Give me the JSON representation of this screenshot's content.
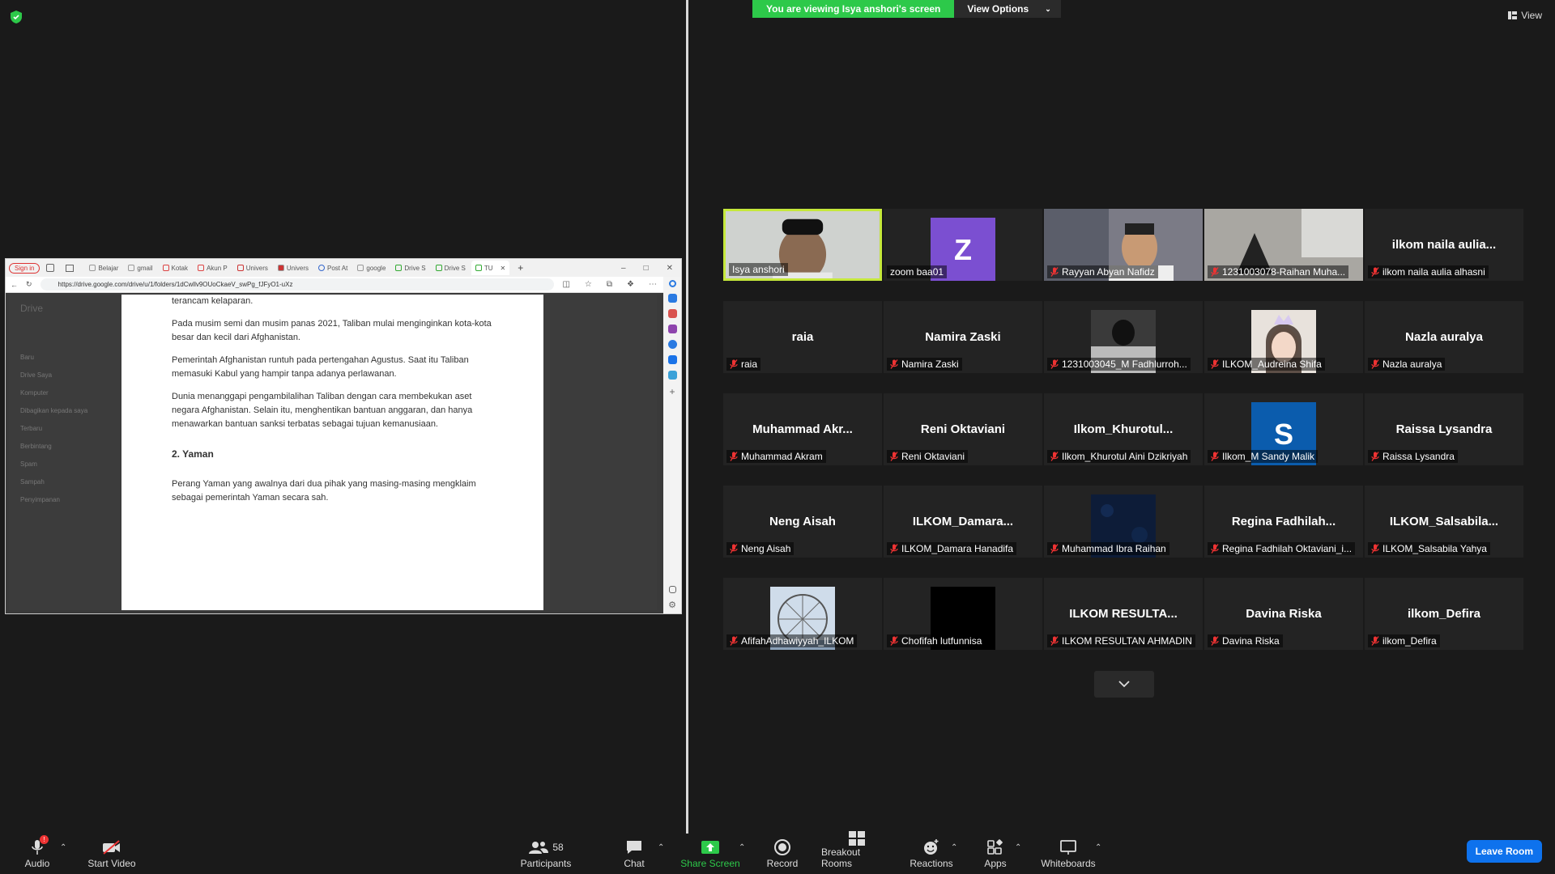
{
  "banner": {
    "viewing": "You are viewing Isya anshori's screen",
    "view_options": "View Options",
    "view": "View"
  },
  "shared": {
    "signin": "Sign in",
    "tabs": [
      "Belajar",
      "gmail",
      "Kotak",
      "Akun P",
      "Univers",
      "Univers",
      "Post At",
      "google",
      "Drive S",
      "Drive S",
      "TU"
    ],
    "url": "https://drive.google.com/drive/u/1/folders/1dCwllv9OUoCkaeV_swPg_fJFyO1-uXz",
    "drive_logo": "Drive",
    "drive_sidebar": [
      "Baru",
      "Drive Saya",
      "Komputer",
      "Dibagikan kepada saya",
      "Terbaru",
      "Berbintang",
      "Spam",
      "Sampah",
      "Penyimpanan"
    ],
    "doc": {
      "p0": "terancam kelaparan.",
      "p1": "Pada musim semi dan musim panas 2021, Taliban mulai menginginkan kota-kota besar dan kecil dari Afghanistan.",
      "p2": "Pemerintah Afghanistan runtuh pada pertengahan Agustus. Saat itu Taliban memasuki Kabul yang hampir tanpa adanya perlawanan.",
      "p3": "Dunia menanggapi pengambilalihan Taliban dengan cara membekukan aset negara Afghanistan. Selain itu, menghentikan bantuan anggaran, dan hanya menawarkan bantuan sanksi terbatas sebagai tujuan kemanusiaan.",
      "heading": "2. Yaman",
      "p4": "Perang Yaman yang awalnya dari dua pihak yang masing-masing mengklaim sebagai pemerintah Yaman secara sah."
    }
  },
  "participants": [
    {
      "center": "",
      "label": "Isya anshori",
      "kind": "photo-full",
      "muted": false,
      "active": true
    },
    {
      "center": "",
      "label": "zoom baa01",
      "kind": "avatar",
      "letter": "Z",
      "color": "#7b4fd1",
      "muted": false
    },
    {
      "center": "",
      "label": "Rayyan Abyan Nafidz",
      "kind": "photo-full",
      "muted": true
    },
    {
      "center": "",
      "label": "1231003078-Raihan Muha...",
      "kind": "photo-full",
      "muted": true
    },
    {
      "center": "ilkom  naila  aulia...",
      "label": "ilkom naila aulia alhasni",
      "kind": "name",
      "muted": true
    },
    {
      "center": "raia",
      "label": "raia",
      "kind": "name",
      "muted": true
    },
    {
      "center": "Namira Zaski",
      "label": "Namira Zaski",
      "kind": "name",
      "muted": true
    },
    {
      "center": "",
      "label": "1231003045_M Fadhlurroh...",
      "kind": "photo",
      "muted": true
    },
    {
      "center": "",
      "label": "ILKOM_Audreina Shifa",
      "kind": "photo",
      "muted": true
    },
    {
      "center": "Nazla auralya",
      "label": "Nazla auralya",
      "kind": "name",
      "muted": true
    },
    {
      "center": "Muhammad  Akr...",
      "label": "Muhammad Akram",
      "kind": "name",
      "muted": true
    },
    {
      "center": "Reni Oktaviani",
      "label": "Reni Oktaviani",
      "kind": "name",
      "muted": true
    },
    {
      "center": "Ilkom_Khurotul...",
      "label": "Ilkom_Khurotul Aini Dzikriyah",
      "kind": "name",
      "muted": true
    },
    {
      "center": "",
      "label": "Ilkom_M Sandy Malik",
      "kind": "avatar",
      "letter": "S",
      "color": "#0b5cad",
      "muted": true
    },
    {
      "center": "Raissa Lysandra",
      "label": "Raissa Lysandra",
      "kind": "name",
      "muted": true
    },
    {
      "center": "Neng Aisah",
      "label": "Neng Aisah",
      "kind": "name",
      "muted": true
    },
    {
      "center": "ILKOM_Damara...",
      "label": "ILKOM_Damara Hanadifa",
      "kind": "name",
      "muted": true
    },
    {
      "center": "",
      "label": "Muhammad Ibra Raihan",
      "kind": "photo",
      "muted": true
    },
    {
      "center": "Regina  Fadhilah...",
      "label": "Regina Fadhilah Oktaviani_i...",
      "kind": "name",
      "muted": true
    },
    {
      "center": "ILKOM_Salsabila...",
      "label": "ILKOM_Salsabila Yahya",
      "kind": "name",
      "muted": true
    },
    {
      "center": "",
      "label": "AfifahAdhawiyyah_ILKOM",
      "kind": "photo",
      "muted": true
    },
    {
      "center": "",
      "label": "Chofifah lutfunnisa",
      "kind": "photo",
      "muted": true
    },
    {
      "center": "ILKOM  RESULTA...",
      "label": "ILKOM RESULTAN AHMADIN",
      "kind": "name",
      "muted": true
    },
    {
      "center": "Davina Riska",
      "label": "Davina Riska",
      "kind": "name",
      "muted": true
    },
    {
      "center": "ilkom_Defira",
      "label": "ilkom_Defira",
      "kind": "name",
      "muted": true
    }
  ],
  "toolbar": {
    "audio": "Audio",
    "audio_badge": "!",
    "start_video": "Start Video",
    "participants": "Participants",
    "participants_count": "58",
    "chat": "Chat",
    "share_screen": "Share Screen",
    "record": "Record",
    "breakout": "Breakout Rooms",
    "reactions": "Reactions",
    "apps": "Apps",
    "whiteboards": "Whiteboards",
    "leave": "Leave Room"
  },
  "colors": {
    "accent_green": "#2dc94a",
    "active_speaker": "#c5e83b",
    "leave_blue": "#0e72ed"
  }
}
